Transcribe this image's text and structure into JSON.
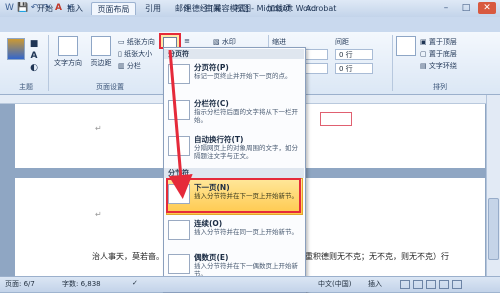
{
  "window": {
    "title": "退德经 [兼容模式] - Microsoft Word",
    "controls": [
      "–",
      "□",
      "✕"
    ]
  },
  "quick_access": [
    "💾",
    "↶",
    "↷",
    "A",
    "▾"
  ],
  "tabs": [
    {
      "label": "开始"
    },
    {
      "label": "插入"
    },
    {
      "label": "页面布局"
    },
    {
      "label": "引用"
    },
    {
      "label": "邮件"
    },
    {
      "label": "审阅"
    },
    {
      "label": "视图"
    },
    {
      "label": "加载项"
    },
    {
      "label": "Acrobat"
    }
  ],
  "ribbon": {
    "groups": [
      "主题",
      "页面设置",
      "排列"
    ],
    "buttons": {
      "text_direction": "文字方向",
      "margins": "页边距",
      "paper_direction": "纸张方向",
      "paper_size": "纸张大小",
      "columns": "分栏",
      "watermark": "水印",
      "indent": "缩进",
      "spacing": "间距",
      "bring_front": "置于顶层",
      "send_back": "置于底层",
      "text_wrap": "文字环绕"
    },
    "spinners": [
      "0 行",
      "0 行"
    ]
  },
  "menu": {
    "section_page_breaks": "分页符",
    "section_section_breaks": "分节符",
    "items": [
      {
        "title": "分页符(P)",
        "desc": "标记一页终止并开始下一页的点。"
      },
      {
        "title": "分栏符(C)",
        "desc": "指示分栏符后面的文字将从下一栏开始。"
      },
      {
        "title": "自动换行符(T)",
        "desc": "分隔网页上的对象周围的文字，如分隔题注文字与正文。"
      },
      {
        "title": "下一页(N)",
        "desc": "插入分节符并在下一页上开始新节。"
      },
      {
        "title": "连续(O)",
        "desc": "插入分节符并在同一页上开始新节。"
      },
      {
        "title": "偶数页(E)",
        "desc": "插入分节符并在下一偶数页上开始新节。"
      }
    ]
  },
  "document": {
    "line1_left": "治人事天，莫若啬。",
    "line1_right": "重积德则无不克；无不克，则无不克）行"
  },
  "statusbar": {
    "page": "页面: 6/7",
    "words": "字数: 6,838",
    "lang": "中文(中国)",
    "mode": "插入"
  }
}
